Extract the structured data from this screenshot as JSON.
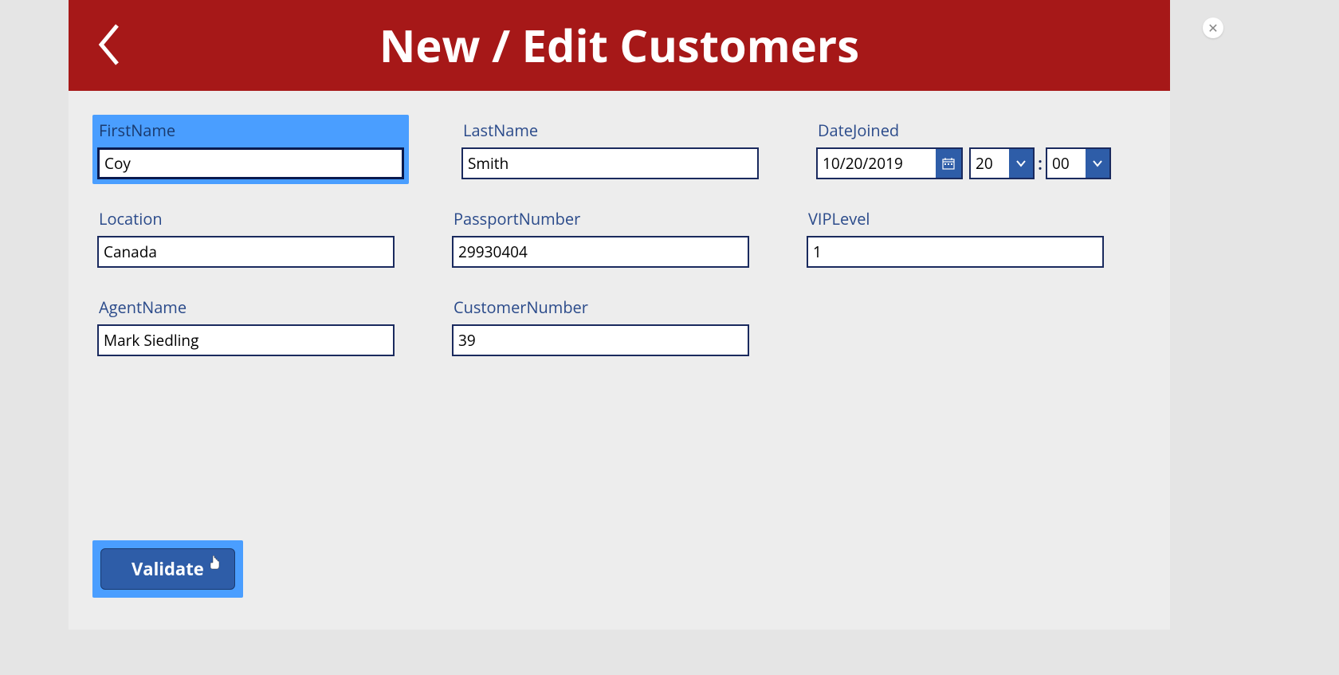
{
  "header": {
    "title": "New / Edit Customers"
  },
  "fields": {
    "firstName": {
      "label": "FirstName",
      "value": "Coy"
    },
    "lastName": {
      "label": "LastName",
      "value": "Smith"
    },
    "dateJoined": {
      "label": "DateJoined",
      "date": "10/20/2019",
      "hour": "20",
      "minute": "00"
    },
    "location": {
      "label": "Location",
      "value": "Canada"
    },
    "passportNumber": {
      "label": "PassportNumber",
      "value": "29930404"
    },
    "vipLevel": {
      "label": "VIPLevel",
      "value": "1"
    },
    "agentName": {
      "label": "AgentName",
      "value": "Mark Siedling"
    },
    "customerNumber": {
      "label": "CustomerNumber",
      "value": "39"
    }
  },
  "buttons": {
    "validate": "Validate"
  },
  "timeSeparator": ":"
}
